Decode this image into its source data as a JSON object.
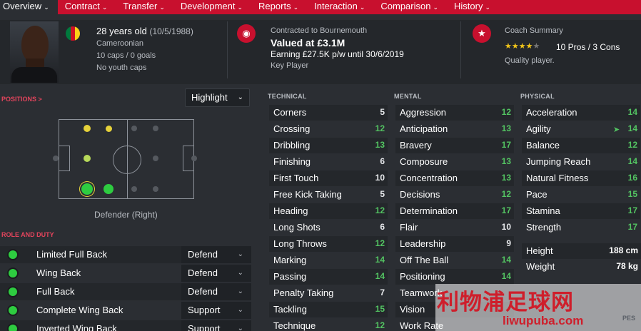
{
  "nav": {
    "tabs": [
      {
        "label": "Overview",
        "active": true
      },
      {
        "label": "Contract"
      },
      {
        "label": "Transfer"
      },
      {
        "label": "Development"
      },
      {
        "label": "Reports"
      },
      {
        "label": "Interaction"
      },
      {
        "label": "Comparison"
      },
      {
        "label": "History"
      }
    ]
  },
  "player": {
    "age": "28 years old",
    "dob": "(10/5/1988)",
    "nationality": "Cameroonian",
    "caps": "10 caps / 0 goals",
    "youth_caps": "No youth caps"
  },
  "contract": {
    "label": "Contracted to Bournemouth",
    "value": "Valued at £3.1M",
    "earning": "Earning £27.5K p/w until 30/6/2019",
    "status": "Key Player"
  },
  "coach": {
    "label": "Coach Summary",
    "rating": 3.5,
    "pros_cons": "10 Pros / 3 Cons",
    "summary": "Quality player."
  },
  "positions": {
    "label": "POSITIONS",
    "arrow": ">",
    "view_select": "Highlight",
    "position_name": "Defender (Right)"
  },
  "role_duty": {
    "label": "ROLE AND DUTY",
    "roles": [
      {
        "name": "Limited Full Back",
        "duty": "Defend"
      },
      {
        "name": "Wing Back",
        "duty": "Defend"
      },
      {
        "name": "Full Back",
        "duty": "Defend"
      },
      {
        "name": "Complete Wing Back",
        "duty": "Support"
      },
      {
        "name": "Inverted Wing Back",
        "duty": "Support"
      }
    ]
  },
  "attributes": {
    "technical": {
      "label": "TECHNICAL",
      "items": [
        {
          "name": "Corners",
          "value": "5",
          "color": "white"
        },
        {
          "name": "Crossing",
          "value": "12",
          "color": "green"
        },
        {
          "name": "Dribbling",
          "value": "13",
          "color": "green"
        },
        {
          "name": "Finishing",
          "value": "6",
          "color": "white"
        },
        {
          "name": "First Touch",
          "value": "10",
          "color": "white"
        },
        {
          "name": "Free Kick Taking",
          "value": "5",
          "color": "white"
        },
        {
          "name": "Heading",
          "value": "12",
          "color": "green"
        },
        {
          "name": "Long Shots",
          "value": "6",
          "color": "white"
        },
        {
          "name": "Long Throws",
          "value": "12",
          "color": "green"
        },
        {
          "name": "Marking",
          "value": "14",
          "color": "green"
        },
        {
          "name": "Passing",
          "value": "14",
          "color": "green"
        },
        {
          "name": "Penalty Taking",
          "value": "7",
          "color": "white"
        },
        {
          "name": "Tackling",
          "value": "15",
          "color": "green"
        },
        {
          "name": "Technique",
          "value": "12",
          "color": "green"
        }
      ]
    },
    "mental": {
      "label": "MENTAL",
      "items": [
        {
          "name": "Aggression",
          "value": "12",
          "color": "green"
        },
        {
          "name": "Anticipation",
          "value": "13",
          "color": "green"
        },
        {
          "name": "Bravery",
          "value": "17",
          "color": "green"
        },
        {
          "name": "Composure",
          "value": "13",
          "color": "green"
        },
        {
          "name": "Concentration",
          "value": "13",
          "color": "green"
        },
        {
          "name": "Decisions",
          "value": "12",
          "color": "green"
        },
        {
          "name": "Determination",
          "value": "17",
          "color": "green"
        },
        {
          "name": "Flair",
          "value": "10",
          "color": "white"
        },
        {
          "name": "Leadership",
          "value": "9",
          "color": "white"
        },
        {
          "name": "Off The Ball",
          "value": "14",
          "color": "green"
        },
        {
          "name": "Positioning",
          "value": "14",
          "color": "green"
        },
        {
          "name": "Teamwork",
          "value": "",
          "color": "green"
        },
        {
          "name": "Vision",
          "value": "",
          "color": "green"
        },
        {
          "name": "Work Rate",
          "value": "",
          "color": "green"
        }
      ]
    },
    "physical": {
      "label": "PHYSICAL",
      "items": [
        {
          "name": "Acceleration",
          "value": "14",
          "color": "green"
        },
        {
          "name": "Agility",
          "value": "14",
          "color": "green",
          "trend": "up"
        },
        {
          "name": "Balance",
          "value": "12",
          "color": "green"
        },
        {
          "name": "Jumping Reach",
          "value": "14",
          "color": "green"
        },
        {
          "name": "Natural Fitness",
          "value": "16",
          "color": "green"
        },
        {
          "name": "Pace",
          "value": "15",
          "color": "green"
        },
        {
          "name": "Stamina",
          "value": "17",
          "color": "green"
        },
        {
          "name": "Strength",
          "value": "17",
          "color": "green"
        }
      ]
    },
    "body": {
      "height_label": "Height",
      "height": "188 cm",
      "weight_label": "Weight",
      "weight": "78 kg"
    }
  },
  "watermark": {
    "cn": "利物浦足球网",
    "url": "liwupuba.com",
    "pes": "PES"
  },
  "colors": {
    "accent": "#c8102e",
    "good": "#53c462",
    "bg": "#2b2e33"
  }
}
